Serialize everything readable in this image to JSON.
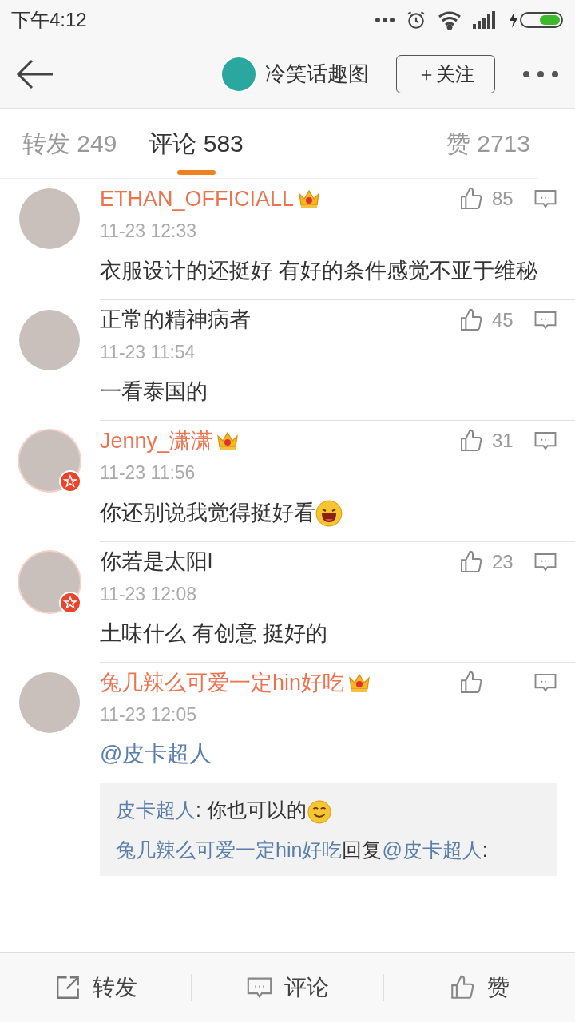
{
  "status_bar": {
    "time": "下午4:12"
  },
  "nav": {
    "account_name": "冷笑话趣图",
    "follow_label": "＋关注"
  },
  "tabs": [
    {
      "label": "转发",
      "count": "249",
      "selected": false
    },
    {
      "label": "评论",
      "count": "583",
      "selected": true
    },
    {
      "label": "赞",
      "count": "2713",
      "selected": false
    }
  ],
  "comments": [
    {
      "name": "ETHAN_OFFICIALL",
      "vip": true,
      "verified": false,
      "time": "11-23 12:33",
      "likes": "85",
      "text": "衣服设计的还挺好 有好的条件感觉不亚于维秘"
    },
    {
      "name": "正常的精神病者",
      "vip": false,
      "verified": false,
      "time": "11-23 11:54",
      "likes": "45",
      "text": "一看泰国的"
    },
    {
      "name": "Jenny_潇潇",
      "vip": true,
      "verified": true,
      "time": "11-23 11:56",
      "likes": "31",
      "text": "你还别说我觉得挺好看",
      "emoji": {
        "kind": "grin"
      }
    },
    {
      "name": "你若是太阳l",
      "vip": false,
      "verified": true,
      "time": "11-23 12:08",
      "likes": "23",
      "text": "土味什么   有创意   挺好的"
    },
    {
      "name": "兔几辣么可爱一定hin好吃",
      "vip": true,
      "verified": false,
      "time": "11-23 12:05",
      "mention": "@皮卡超人",
      "replies": [
        {
          "parts": [
            {
              "kind": "user",
              "text": "皮卡超人"
            },
            {
              "kind": "text",
              "text": ": 你也可以的"
            }
          ],
          "emoji": {
            "kind": "smile"
          }
        },
        {
          "parts": [
            {
              "kind": "user",
              "text": "兔几辣么可爱一定hin好吃"
            },
            {
              "kind": "text",
              "text": "回复"
            },
            {
              "kind": "user",
              "text": "@皮卡超人"
            },
            {
              "kind": "text",
              "text": ":"
            }
          ]
        }
      ]
    }
  ],
  "bottom_bar": [
    {
      "kind": "share",
      "label": "转发"
    },
    {
      "kind": "comment",
      "label": "评论"
    },
    {
      "kind": "like",
      "label": "赞"
    }
  ]
}
